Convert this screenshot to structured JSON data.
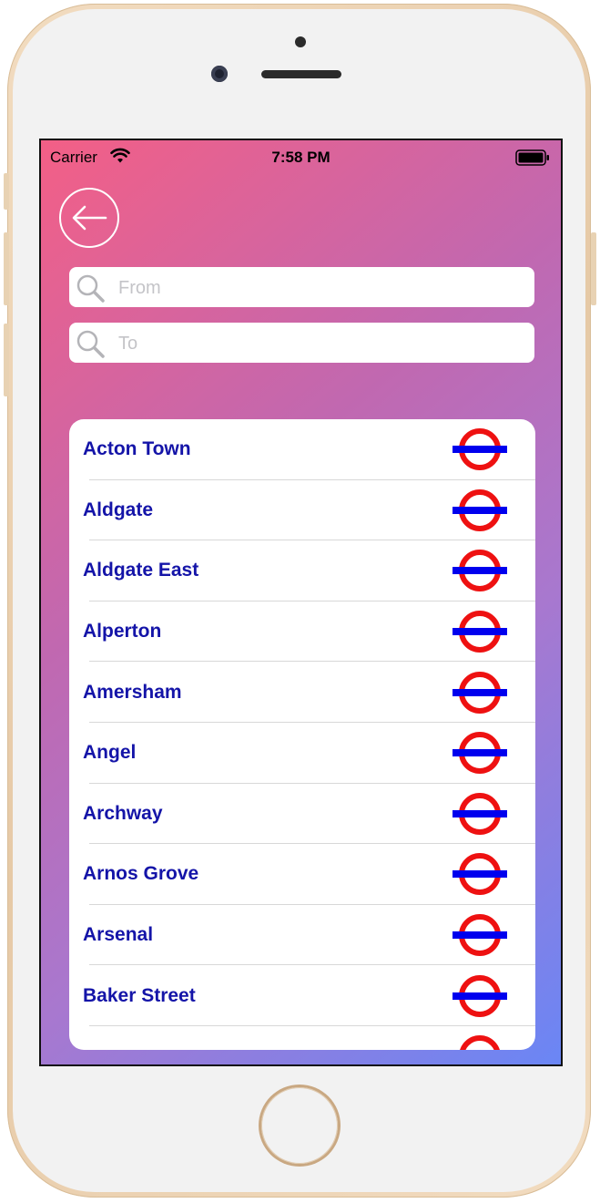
{
  "status_bar": {
    "carrier": "Carrier",
    "time": "7:58 PM"
  },
  "search": {
    "from_placeholder": "From",
    "to_placeholder": "To"
  },
  "stations": [
    {
      "name": "Acton Town"
    },
    {
      "name": "Aldgate"
    },
    {
      "name": "Aldgate East"
    },
    {
      "name": "Alperton"
    },
    {
      "name": "Amersham"
    },
    {
      "name": "Angel"
    },
    {
      "name": "Archway"
    },
    {
      "name": "Arnos Grove"
    },
    {
      "name": "Arsenal"
    },
    {
      "name": "Baker Street"
    },
    {
      "name": ""
    }
  ],
  "colors": {
    "gradient_start": "#f35f86",
    "gradient_end": "#6a86f5",
    "station_text": "#1414a8",
    "roundel_ring": "#ee1111",
    "roundel_bar": "#0000ee"
  },
  "icons": {
    "back": "back-arrow-icon",
    "search": "search-icon",
    "station": "underground-roundel-icon",
    "wifi": "wifi-icon",
    "battery": "battery-icon"
  }
}
